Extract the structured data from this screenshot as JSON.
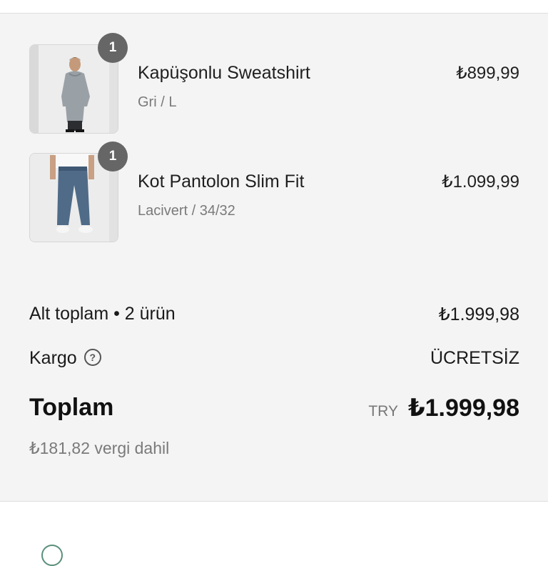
{
  "order_summary": {
    "items": [
      {
        "name": "Kapüşonlu Sweatshirt",
        "variant": "Gri / L",
        "price": "₺899,99",
        "quantity": "1",
        "image_icon": "sweatshirt-product-photo"
      },
      {
        "name": "Kot Pantolon Slim Fit",
        "variant": "Lacivert / 34/32",
        "price": "₺1.099,99",
        "quantity": "1",
        "image_icon": "jeans-product-photo"
      }
    ],
    "subtotal": {
      "label": "Alt toplam • 2 ürün",
      "value": "₺1.999,98"
    },
    "shipping": {
      "label": "Kargo",
      "help_icon": "question-circle-icon",
      "value": "ÜCRETSİZ"
    },
    "total": {
      "label": "Toplam",
      "currency": "TRY",
      "value": "₺1.999,98"
    },
    "tax_note": "₺181,82 vergi dahil"
  },
  "colors": {
    "summary_background": "#f4f4f4",
    "badge": "#666666",
    "muted_text": "#7a7a7a"
  }
}
